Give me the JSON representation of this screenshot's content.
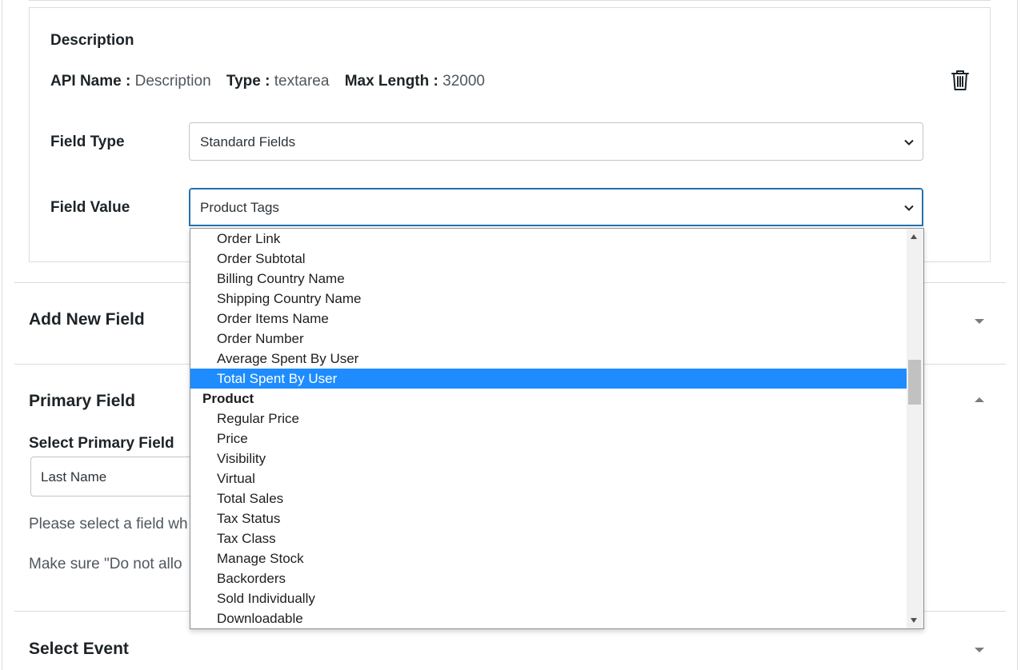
{
  "card": {
    "title": "Description",
    "api_name_label": "API Name :",
    "api_name_value": "Description",
    "type_label": "Type :",
    "type_value": "textarea",
    "max_length_label": "Max Length :",
    "max_length_value": "32000",
    "field_type_label": "Field Type",
    "field_type_value": "Standard Fields",
    "field_value_label": "Field Value",
    "field_value_value": "Product Tags"
  },
  "sections": {
    "add_new_field": "Add New Field",
    "primary_field": "Primary Field",
    "select_primary_label": "Select Primary Field",
    "primary_value": "Last Name",
    "help_1": "Please select a field wh",
    "help_2": "Make sure \"Do not allo",
    "select_event": "Select Event"
  },
  "dropdown": {
    "options_top": [
      "Order Link",
      "Order Subtotal",
      "Billing Country Name",
      "Shipping Country Name",
      "Order Items Name",
      "Order Number",
      "Average Spent By User"
    ],
    "selected": "Total Spent By User",
    "group": "Product",
    "options_product": [
      "Regular Price",
      "Price",
      "Visibility",
      "Virtual",
      "Total Sales",
      "Tax Status",
      "Tax Class",
      "Manage Stock",
      "Backorders",
      "Sold Individually",
      "Downloadable"
    ]
  },
  "colors": {
    "selected_bg": "#1e8cff",
    "focus_border": "#2271b1"
  },
  "icons": [
    "trash-icon",
    "chevron-down-icon",
    "caret-down-icon",
    "caret-up-icon"
  ]
}
